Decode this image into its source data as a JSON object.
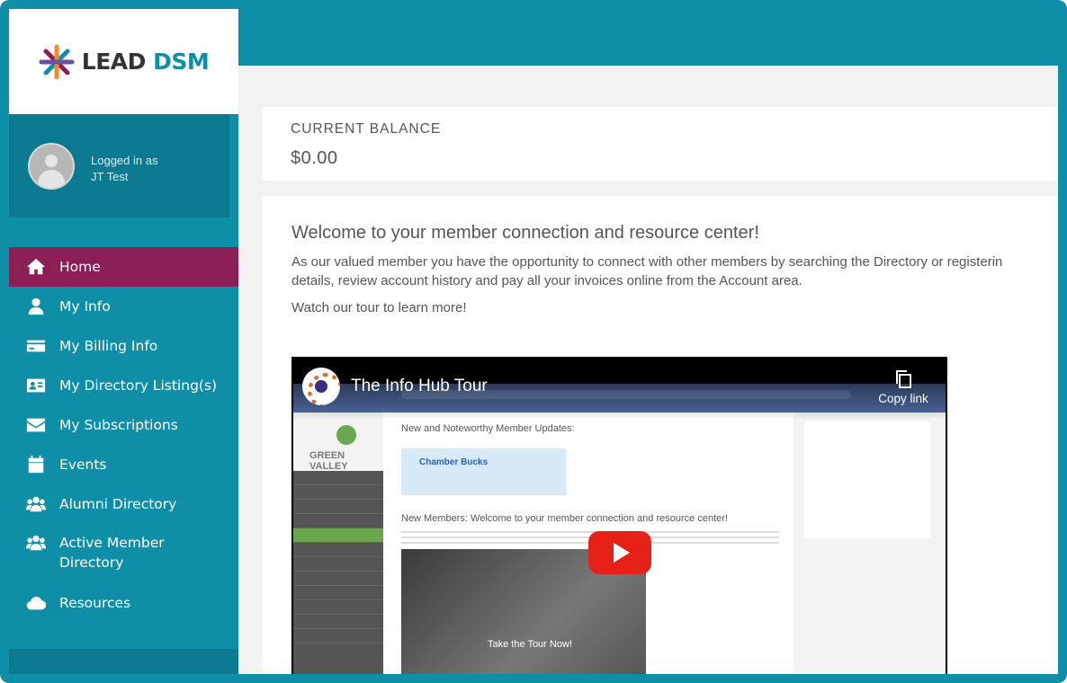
{
  "brand": {
    "part1": "LEAD",
    "part2": "DSM"
  },
  "user": {
    "logged_in_label": "Logged in as",
    "name": "JT Test"
  },
  "nav": [
    {
      "label": "Home",
      "icon": "home-icon",
      "active": true
    },
    {
      "label": "My Info",
      "icon": "user-icon"
    },
    {
      "label": "My Billing Info",
      "icon": "credit-card-icon"
    },
    {
      "label": "My Directory Listing(s)",
      "icon": "id-card-icon"
    },
    {
      "label": "My Subscriptions",
      "icon": "envelope-icon"
    },
    {
      "label": "Events",
      "icon": "calendar-icon"
    },
    {
      "label": "Alumni Directory",
      "icon": "users-icon"
    },
    {
      "label": "Active Member Directory",
      "icon": "users-icon"
    },
    {
      "label": "Resources",
      "icon": "cloud-icon"
    }
  ],
  "balance": {
    "label": "CURRENT BALANCE",
    "value": "$0.00"
  },
  "welcome": {
    "title": "Welcome to your member connection and resource center!",
    "line1": "As our valued member you have the opportunity to connect with other members by searching the Directory or registerin",
    "line2": "details, review account history and pay all your invoices online from the Account area.",
    "tour": "Watch our tour to learn more!"
  },
  "video": {
    "title": "The Info Hub Tour",
    "copy_link": "Copy link",
    "embedded": {
      "logo": "GREEN VALLEY",
      "heading": "New and Noteworthy Member Updates:",
      "chamber": "Chamber Bucks",
      "heading2": "New Members: Welcome to your member connection and resource center!",
      "clip_text": "Take the Tour Now!"
    }
  },
  "colors": {
    "teal": "#0f8ea8",
    "active": "#8b1f55"
  }
}
